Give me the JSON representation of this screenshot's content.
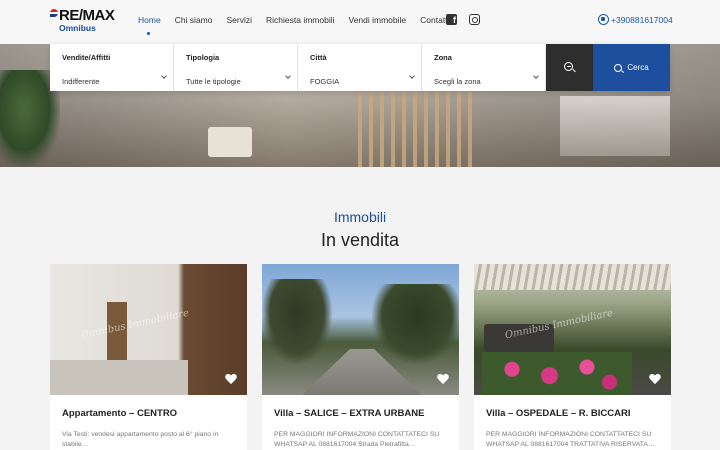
{
  "brand": {
    "logo_top": "RE/MAX",
    "logo_sub": "Omnibus"
  },
  "nav": {
    "items": [
      {
        "label": "Home",
        "active": true
      },
      {
        "label": "Chi siamo"
      },
      {
        "label": "Servizi"
      },
      {
        "label": "Richiesta immobili"
      },
      {
        "label": "Vendi immobile"
      },
      {
        "label": "Contatti"
      }
    ],
    "social": [
      "facebook-icon",
      "instagram-icon"
    ],
    "phone": "+390881617004"
  },
  "search": {
    "fields": [
      {
        "label": "Vendite/Affitti",
        "value": "Indifferente"
      },
      {
        "label": "Tipologia",
        "value": "Tutte le tipologie"
      },
      {
        "label": "Città",
        "value": "FOGGIA"
      },
      {
        "label": "Zona",
        "value": "Scegli la zona"
      }
    ],
    "submit_label": "Cerca"
  },
  "section": {
    "kicker": "Immobili",
    "title": "In vendita"
  },
  "listings": [
    {
      "title": "Appartamento – CENTRO",
      "desc": "Via Testi: vendesi appartamento posto al 6° piano in stabile…",
      "watermark": "Omnibus Immobiliare"
    },
    {
      "title": "Villa – SALICE – EXTRA URBANE",
      "desc": "PER MAGGIORI INFORMAZIONI CONTATTATECI SU WHATSAP AL 0881617004 Strada Pietrafitta…",
      "watermark": ""
    },
    {
      "title": "Villa – OSPEDALE – R. BICCARI",
      "desc": "PER MAGGIORI INFORMAZIONI CONTATTATECI SU WHATSAP AL 0881617004 TRATTATIVA RISERVATA…",
      "watermark": "Omnibus Immobiliare"
    }
  ],
  "colors": {
    "accent": "#1d4f9e",
    "dark_button": "#2e2e2e"
  }
}
